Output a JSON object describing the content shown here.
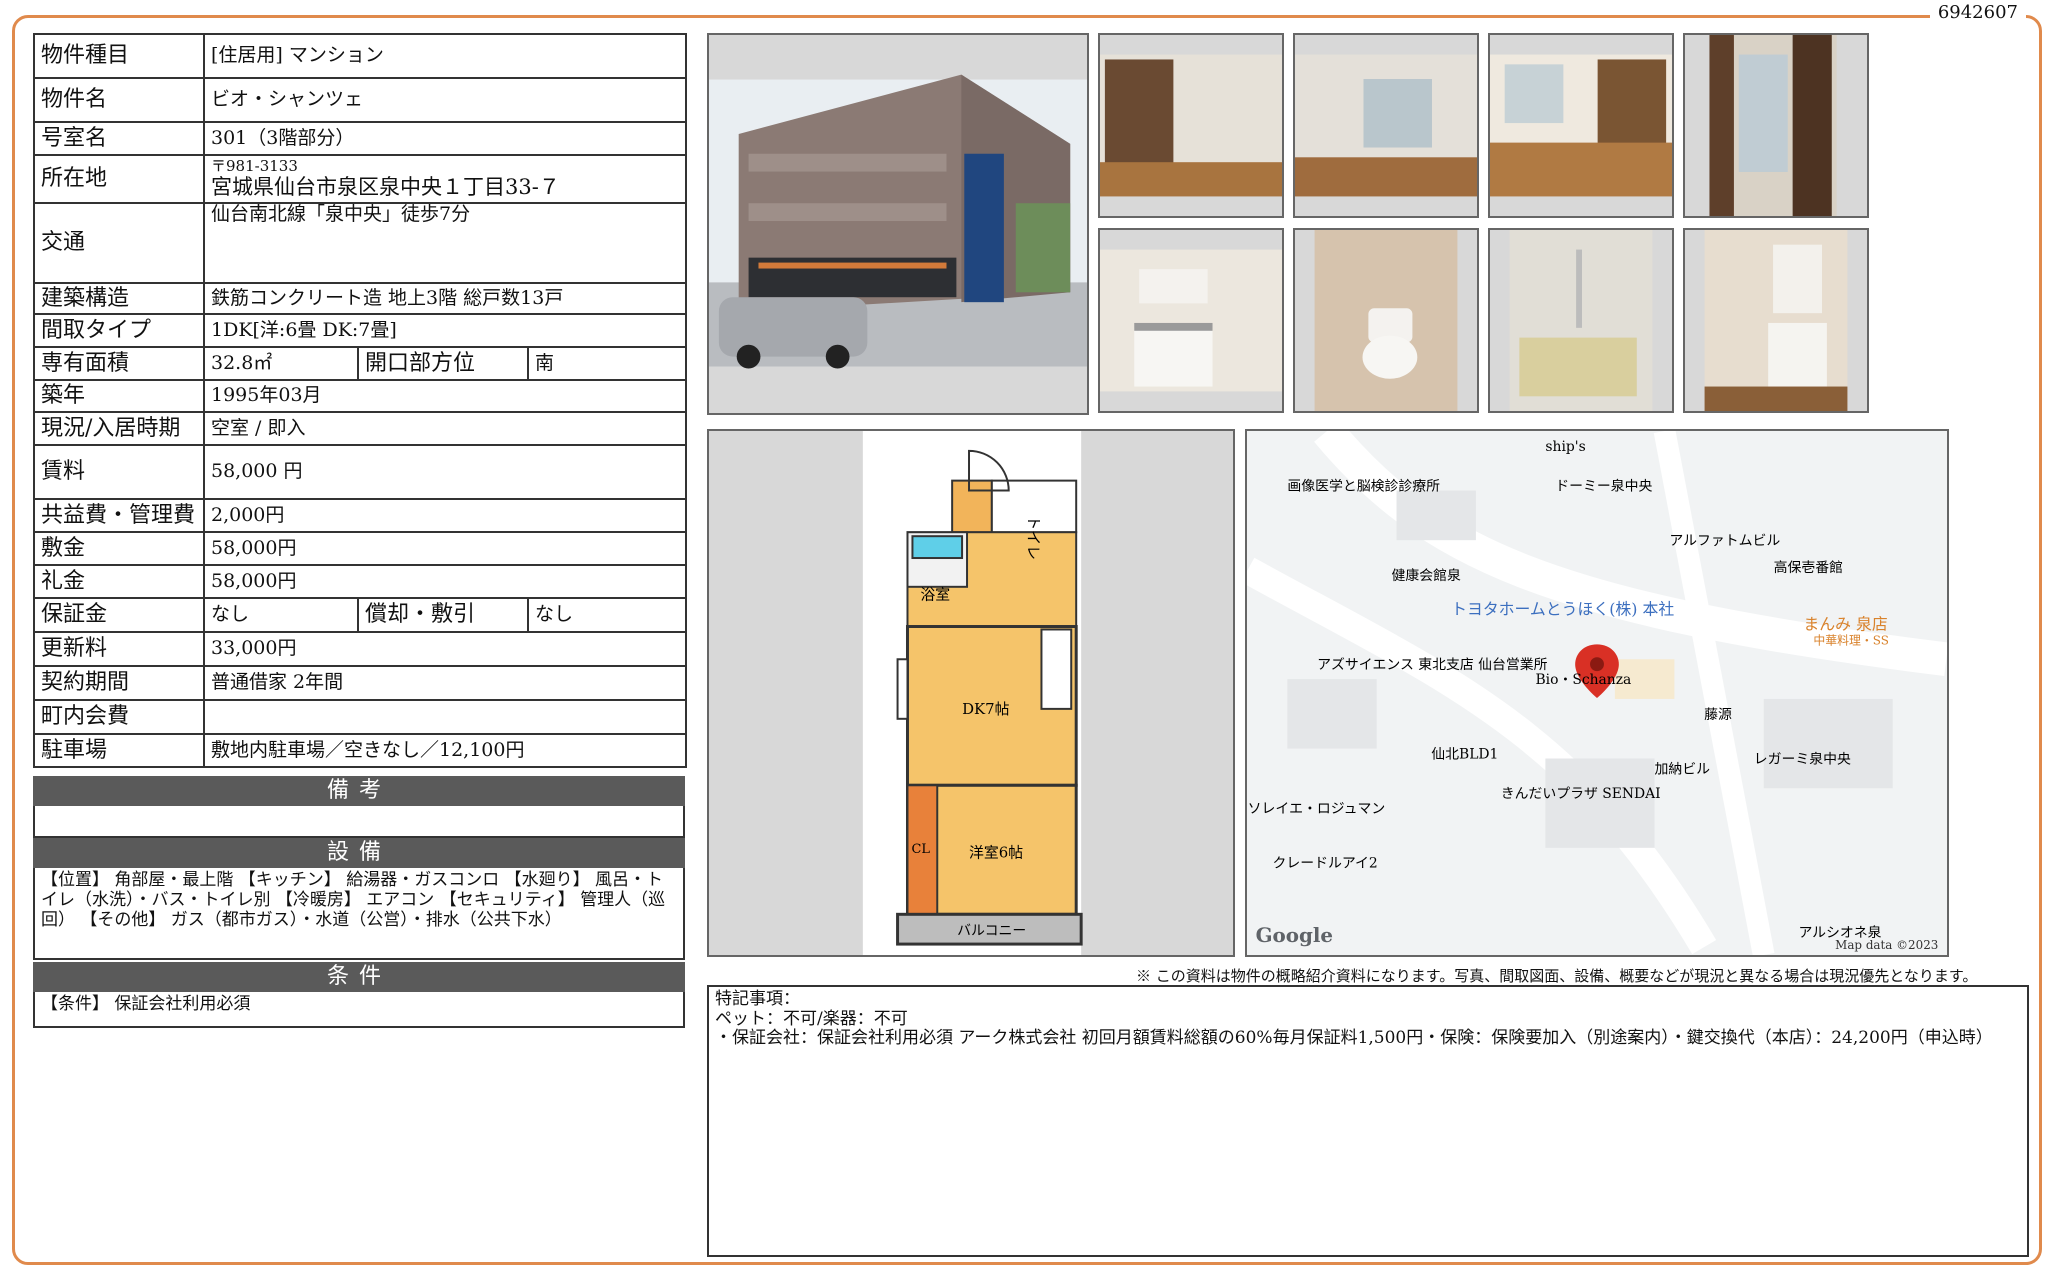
{
  "ref_no": "6942607",
  "info": {
    "type_label": "物件種目",
    "type_value": "[住居用] マンション",
    "name_label": "物件名",
    "name_value": "ビオ・シャンツェ",
    "room_label": "号室名",
    "room_value": "301（3階部分）",
    "address_label": "所在地",
    "postal": "〒981-3133",
    "address_value": "宮城県仙台市泉区泉中央１丁目33-７",
    "access_label": "交通",
    "access_value": "仙台南北線「泉中央」徒歩7分",
    "structure_label": "建築構造",
    "structure_value": "鉄筋コンクリート造 地上3階 総戸数13戸",
    "layout_label": "間取タイプ",
    "layout_value": "1DK[洋:6畳 DK:7畳]",
    "area_label": "専有面積",
    "area_value": "32.8㎡",
    "facing_label": "開口部方位",
    "facing_value": "南",
    "built_label": "築年",
    "built_value": "1995年03月",
    "status_label": "現況/入居時期",
    "status_value": "空室 / 即入",
    "rent_label": "賃料",
    "rent_value": "58,000 円",
    "fee_label": "共益費・管理費",
    "fee_value": "2,000円",
    "deposit_label": "敷金",
    "deposit_value": "58,000円",
    "key_money_label": "礼金",
    "key_money_value": "58,000円",
    "guarantee_label": "保証金",
    "guarantee_value": "なし",
    "amort_label": "償却・敷引",
    "amort_value": "なし",
    "renewal_label": "更新料",
    "renewal_value": "33,000円",
    "contract_label": "契約期間",
    "contract_value": "普通借家 2年間",
    "town_fee_label": "町内会費",
    "town_fee_value": "",
    "parking_label": "駐車場",
    "parking_value": "敷地内駐車場／空きなし／12,100円"
  },
  "remarks_band": "備考",
  "remarks_text": "",
  "equipment_band": "設備",
  "equipment_text": "【位置】 角部屋・最上階 【キッチン】 給湯器・ガスコンロ 【水廻り】 風呂・トイレ（水洗）・バス・トイレ別 【冷暖房】 エアコン 【セキュリティ】 管理人（巡回） 【その他】 ガス（都市ガス）・水道（公営）・排水（公共下水）",
  "conditions_band": "条件",
  "conditions_text": "【条件】 保証会社利用必須",
  "floorplan": {
    "toilet": "トイレ",
    "bath": "浴室",
    "dk": "DK7帖",
    "western": "洋室6帖",
    "closet": "CL",
    "balcony": "バルコニー"
  },
  "map": {
    "labels": [
      "ship's",
      "画像医学と脳検診診療所",
      "ドーミー泉中央",
      "アルファトムビル",
      "高保壱番館",
      "健康会館泉",
      "トヨタホームとうほく(株) 本社",
      "まんみ 泉店",
      "中華料理・SS",
      "アズサイエンス 東北支店 仙台営業所",
      "Bio・Schanza",
      "藤源",
      "仙北BLD1",
      "きんだいプラザ SENDAI",
      "加納ビル",
      "レガーミ泉中央",
      "ソレイエ・ロジュマン",
      "クレードルアイ2",
      "アルシオネ泉"
    ],
    "brand": "Google",
    "copyright": "Map data ©2023"
  },
  "disclaimer": "※ この資料は物件の概略紹介資料になります。写真、間取図面、設備、概要などが現況と異なる場合は現況優先となります。",
  "notes": {
    "title": "特記事項：",
    "line1": "ペット：不可/楽器：不可",
    "line2": "・保証会社：保証会社利用必須 アーク株式会社 初回月額賃料総額の60%毎月保証料1,500円・保険：保険要加入（別途案内）・鍵交換代（本店）：24,200円（申込時）"
  },
  "colors": {
    "frame": "#e08a4c",
    "band": "#5a5a5a",
    "pin": "#d93025"
  }
}
